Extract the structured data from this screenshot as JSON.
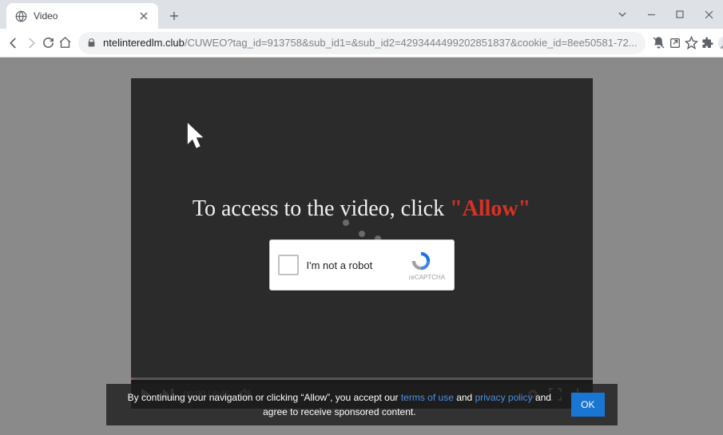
{
  "tab": {
    "title": "Video"
  },
  "omnibox": {
    "domain": "ntelinteredlm.club",
    "path": "/CUWEO?tag_id=913758&sub_id1=&sub_id2=4293444499202851837&cookie_id=8ee50581-72..."
  },
  "video": {
    "prompt_prefix": "To access to the video, click ",
    "prompt_allow": "\"Allow\""
  },
  "captcha": {
    "label": "I'm not a robot",
    "brand": "reCAPTCHA"
  },
  "player": {
    "time": "00:00 / 6:45"
  },
  "consent": {
    "line1_a": "By continuing your navigation or clicking “Allow”, you accept our ",
    "terms": "terms of use",
    "line1_b": " and ",
    "privacy": "privacy policy",
    "line1_c": " and agree to receive sponsored content.",
    "ok": "OK"
  }
}
